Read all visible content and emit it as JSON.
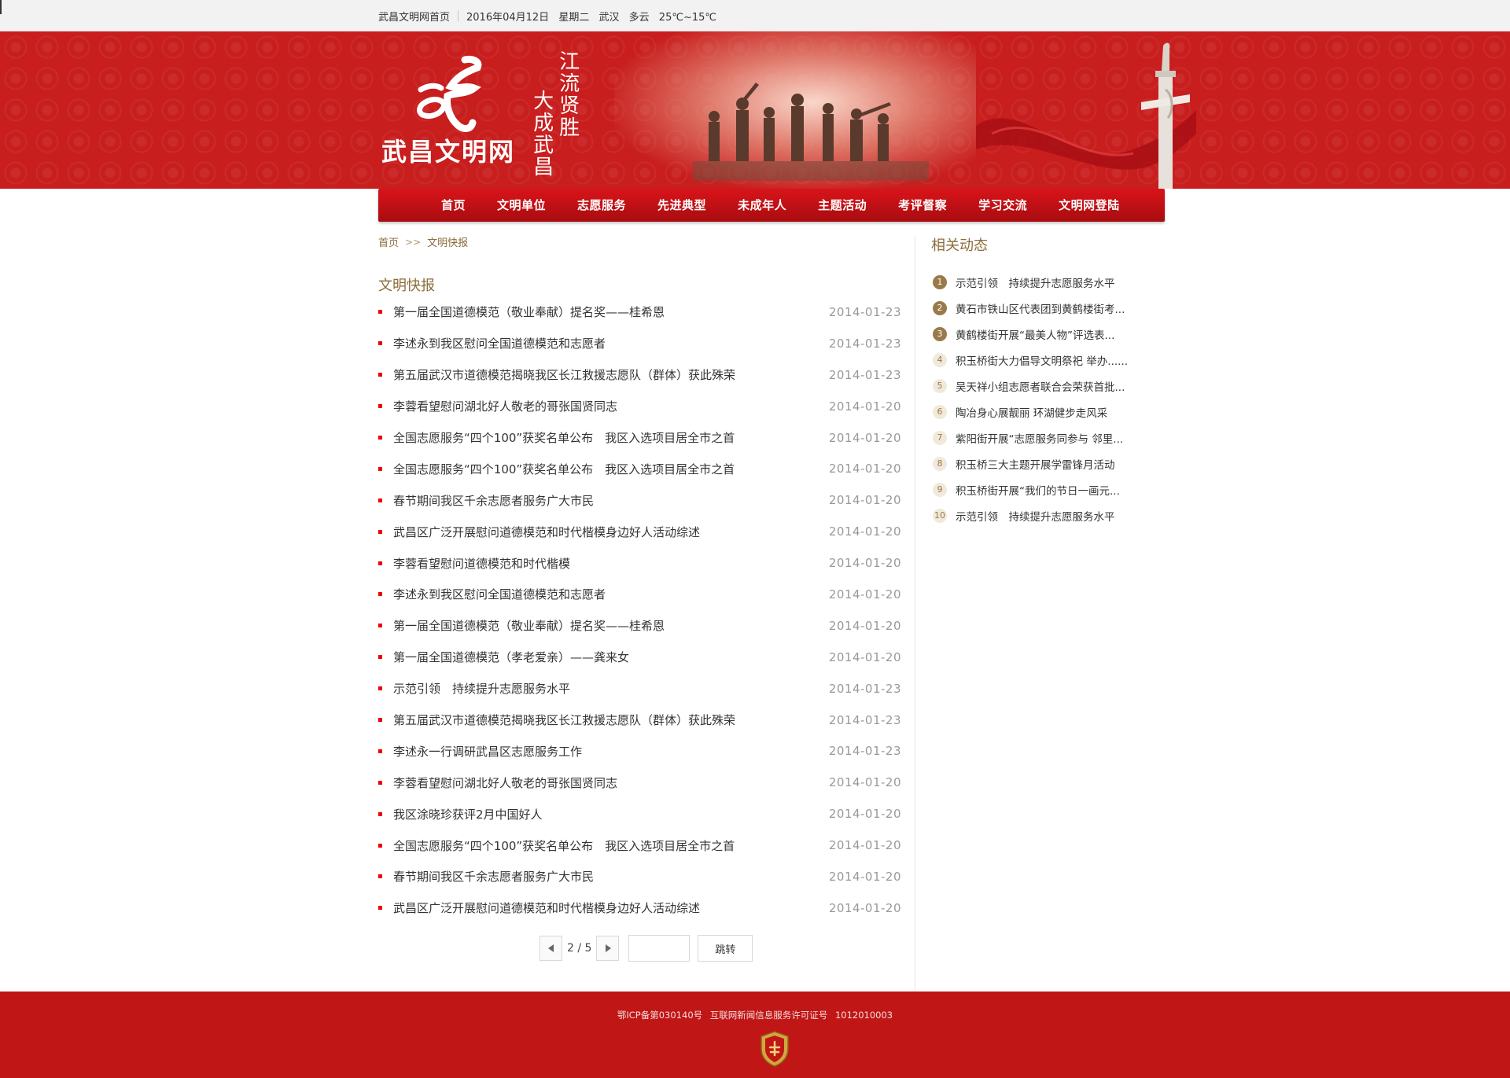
{
  "topbar": {
    "home_link": "武昌文明网首页",
    "date": "2016年04月12日",
    "weekday": "星期二",
    "city": "武汉",
    "weather": "多云",
    "temperature": "25℃~15℃"
  },
  "banner": {
    "logo_text": "武昌文明网",
    "slogan_line1": "江流贤胜",
    "slogan_line2": "大成武昌"
  },
  "nav": {
    "items": [
      {
        "label": "首页"
      },
      {
        "label": "文明单位"
      },
      {
        "label": "志愿服务"
      },
      {
        "label": "先进典型"
      },
      {
        "label": "未成年人"
      },
      {
        "label": "主题活动"
      },
      {
        "label": "考评督察"
      },
      {
        "label": "学习交流"
      },
      {
        "label": "文明网登陆"
      }
    ]
  },
  "breadcrumb": {
    "home": "首页",
    "separator": ">>",
    "current": "文明快报"
  },
  "main": {
    "section_title": "文明快报",
    "articles": [
      {
        "title": "第一届全国道德模范（敬业奉献）提名奖——桂希恩",
        "date": "2014-01-23"
      },
      {
        "title": "李述永到我区慰问全国道德模范和志愿者",
        "date": "2014-01-23"
      },
      {
        "title": "第五届武汉市道德模范揭晓我区长江救援志愿队（群体）获此殊荣",
        "date": "2014-01-23"
      },
      {
        "title": "李蓉看望慰问湖北好人敬老的哥张国贤同志",
        "date": "2014-01-20"
      },
      {
        "title": "全国志愿服务“四个100”获奖名单公布　我区入选项目居全市之首",
        "date": "2014-01-20"
      },
      {
        "title": "全国志愿服务“四个100”获奖名单公布　我区入选项目居全市之首",
        "date": "2014-01-20"
      },
      {
        "title": "春节期间我区千余志愿者服务广大市民",
        "date": "2014-01-20"
      },
      {
        "title": "武昌区广泛开展慰问道德模范和时代楷模身边好人活动综述",
        "date": "2014-01-20"
      },
      {
        "title": "李蓉看望慰问道德模范和时代楷模",
        "date": "2014-01-20"
      },
      {
        "title": "李述永到我区慰问全国道德模范和志愿者",
        "date": "2014-01-20"
      },
      {
        "title": "第一届全国道德模范（敬业奉献）提名奖——桂希恩",
        "date": "2014-01-20"
      },
      {
        "title": "第一届全国道德模范（孝老爱亲）——龚来女",
        "date": "2014-01-20"
      },
      {
        "title": "示范引领　持续提升志愿服务水平",
        "date": "2014-01-23"
      },
      {
        "title": "第五届武汉市道德模范揭晓我区长江救援志愿队（群体）获此殊荣",
        "date": "2014-01-23"
      },
      {
        "title": "李述永一行调研武昌区志愿服务工作",
        "date": "2014-01-23"
      },
      {
        "title": "李蓉看望慰问湖北好人敬老的哥张国贤同志",
        "date": "2014-01-20"
      },
      {
        "title": "我区涂晓珍获评2月中国好人",
        "date": "2014-01-20"
      },
      {
        "title": "全国志愿服务“四个100”获奖名单公布　我区入选项目居全市之首",
        "date": "2014-01-20"
      },
      {
        "title": "春节期间我区千余志愿者服务广大市民",
        "date": "2014-01-20"
      },
      {
        "title": "武昌区广泛开展慰问道德模范和时代楷模身边好人活动综述",
        "date": "2014-01-20"
      }
    ]
  },
  "pager": {
    "current": "2",
    "total": "5",
    "page_text": "2 / 5",
    "prev_icon": "triangle-left-icon",
    "next_icon": "triangle-right-icon",
    "go_label": "跳转",
    "input_value": ""
  },
  "sidebar": {
    "title": "相关动态",
    "items": [
      {
        "num": "1",
        "title": "示范引领　持续提升志愿服务水平"
      },
      {
        "num": "2",
        "title": "黄石市铁山区代表团到黄鹤楼街考..."
      },
      {
        "num": "3",
        "title": "黄鹤楼街开展“最美人物”评选表..."
      },
      {
        "num": "4",
        "title": "积玉桥街大力倡导文明祭祀 举办......"
      },
      {
        "num": "5",
        "title": "吴天祥小组志愿者联合会荣获首批..."
      },
      {
        "num": "6",
        "title": "陶冶身心展靓丽 环湖健步走风采"
      },
      {
        "num": "7",
        "title": "紫阳街开展“志愿服务同参与 邻里..."
      },
      {
        "num": "8",
        "title": "积玉桥三大主题开展学雷锋月活动"
      },
      {
        "num": "9",
        "title": "积玉桥街开展“我们的节日一画元..."
      },
      {
        "num": "10",
        "title": "示范引领　持续提升志愿服务水平"
      }
    ]
  },
  "footer": {
    "icp": "鄂ICP备第030140号",
    "license_label": "互联网新闻信息服务许可证号",
    "license_no": "1012010003",
    "badge_icon": "police-badge-icon"
  },
  "colors": {
    "brand_red": "#c71c1c",
    "nav_red": "#d8141a",
    "accent_gold": "#8b6c3a",
    "bullet_red": "#ee0000"
  }
}
